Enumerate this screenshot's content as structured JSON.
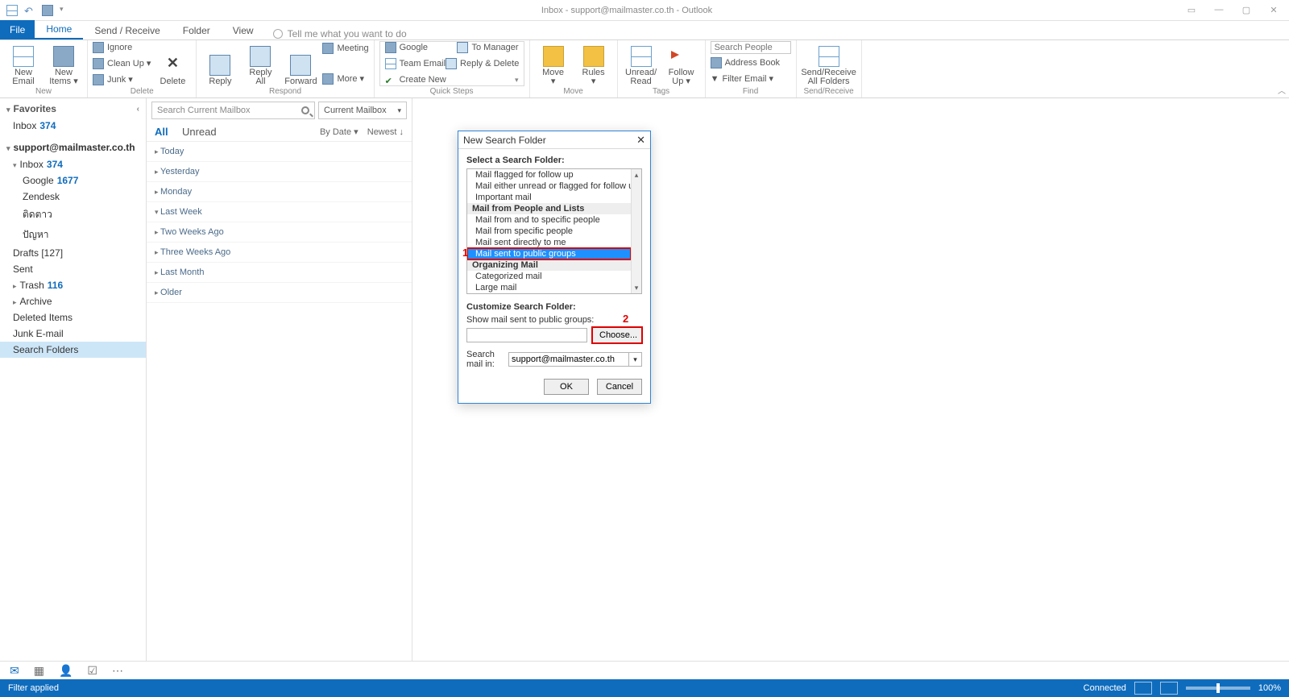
{
  "titlebar": {
    "title": "Inbox - support@mailmaster.co.th - Outlook"
  },
  "tabs": {
    "file": "File",
    "home": "Home",
    "sendreceive": "Send / Receive",
    "folder": "Folder",
    "view": "View",
    "tellme": "Tell me what you want to do"
  },
  "ribbon": {
    "new": {
      "newemail": "New\nEmail",
      "newitems": "New\nItems ▾",
      "group": "New"
    },
    "delete": {
      "ignore": "Ignore",
      "cleanup": "Clean Up ▾",
      "junk": "Junk ▾",
      "delete": "Delete",
      "group": "Delete"
    },
    "respond": {
      "reply": "Reply",
      "replyall": "Reply\nAll",
      "forward": "Forward",
      "meeting": "Meeting",
      "more": "More ▾",
      "group": "Respond"
    },
    "quicksteps": {
      "google": "Google",
      "teamemail": "Team Email",
      "createnew": "Create New",
      "tomgr": "To Manager",
      "replydel": "Reply & Delete",
      "group": "Quick Steps"
    },
    "move": {
      "move": "Move\n▾",
      "rules": "Rules\n▾",
      "group": "Move"
    },
    "tags": {
      "unread": "Unread/\nRead",
      "followup": "Follow\nUp ▾",
      "group": "Tags"
    },
    "find": {
      "searchph": "Search People",
      "ab": "Address Book",
      "filter": "Filter Email ▾",
      "group": "Find"
    },
    "sr": {
      "btn": "Send/Receive\nAll Folders",
      "group": "Send/Receive"
    }
  },
  "nav": {
    "favorites": "Favorites",
    "fav_inbox": "Inbox",
    "fav_inbox_cnt": "374",
    "account": "support@mailmaster.co.th",
    "inbox": "Inbox",
    "inbox_cnt": "374",
    "google": "Google",
    "google_cnt": "1677",
    "zendesk": "Zendesk",
    "th1": "ติดตาว",
    "th2": "ปัญหา",
    "drafts": "Drafts [127]",
    "sent": "Sent",
    "trash": "Trash",
    "trash_cnt": "116",
    "archive": "Archive",
    "deleted": "Deleted Items",
    "junk": "Junk E-mail",
    "searchfolders": "Search Folders"
  },
  "msglist": {
    "search_ph": "Search Current Mailbox",
    "scope": "Current Mailbox",
    "all": "All",
    "unread": "Unread",
    "bydate": "By Date ▾",
    "newest": "Newest ↓",
    "groups": [
      "Today",
      "Yesterday",
      "Monday",
      "Last Week",
      "Two Weeks Ago",
      "Three Weeks Ago",
      "Last Month",
      "Older"
    ]
  },
  "dialog": {
    "title": "New Search Folder",
    "select_label": "Select a Search Folder:",
    "items": [
      {
        "t": "opt",
        "v": "Mail flagged for follow up"
      },
      {
        "t": "opt",
        "v": "Mail either unread or flagged for follow up"
      },
      {
        "t": "opt",
        "v": "Important mail"
      },
      {
        "t": "cat",
        "v": "Mail from People and Lists"
      },
      {
        "t": "opt",
        "v": "Mail from and to specific people"
      },
      {
        "t": "opt",
        "v": "Mail from specific people"
      },
      {
        "t": "opt",
        "v": "Mail sent directly to me"
      },
      {
        "t": "sel",
        "v": "Mail sent to public groups"
      },
      {
        "t": "cat",
        "v": "Organizing Mail"
      },
      {
        "t": "opt",
        "v": "Categorized mail"
      },
      {
        "t": "opt",
        "v": "Large mail"
      }
    ],
    "customize": "Customize Search Folder:",
    "show_label": "Show mail sent to public groups:",
    "choose": "Choose...",
    "searchin_label": "Search mail in:",
    "searchin_value": "support@mailmaster.co.th",
    "ok": "OK",
    "cancel": "Cancel",
    "marker1": "1",
    "marker2": "2"
  },
  "status": {
    "left": "Filter applied",
    "connected": "Connected",
    "zoom": "100%"
  }
}
